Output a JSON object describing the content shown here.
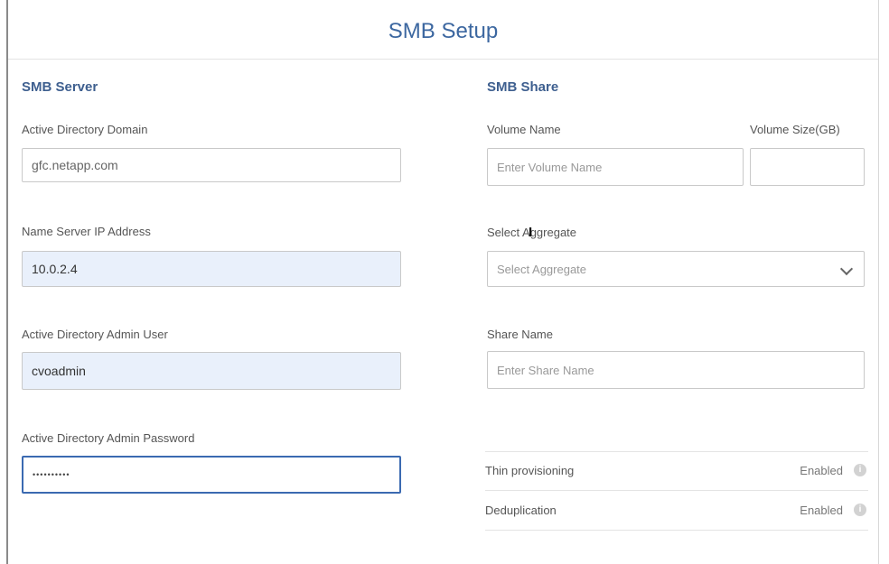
{
  "page": {
    "title": "SMB Setup"
  },
  "smb_server": {
    "section_title": "SMB Server",
    "ad_domain": {
      "label": "Active Directory Domain",
      "value": "gfc.netapp.com"
    },
    "name_server_ip": {
      "label": "Name Server IP Address",
      "value": "10.0.2.4"
    },
    "ad_admin_user": {
      "label": "Active Directory Admin User",
      "value": "cvoadmin"
    },
    "ad_admin_password": {
      "label": "Active Directory Admin Password",
      "value": "••••••••••"
    }
  },
  "smb_share": {
    "section_title": "SMB Share",
    "volume_name": {
      "label": "Volume Name",
      "placeholder": "Enter Volume Name"
    },
    "volume_size": {
      "label": "Volume Size(GB)",
      "value": ""
    },
    "aggregate": {
      "label": "Select Aggregate",
      "placeholder": "Select Aggregate"
    },
    "share_name": {
      "label": "Share Name",
      "placeholder": "Enter Share Name"
    },
    "settings": [
      {
        "label": "Thin provisioning",
        "value": "Enabled"
      },
      {
        "label": "Deduplication",
        "value": "Enabled"
      }
    ]
  },
  "icons": {
    "info": "info-icon",
    "dropdown": "chevron-down-icon",
    "cursor": "text-cursor-icon"
  },
  "colors": {
    "accent": "#3c67a0",
    "filled_input": "#e9f0fb",
    "focus_border": "#3b6ab1"
  }
}
